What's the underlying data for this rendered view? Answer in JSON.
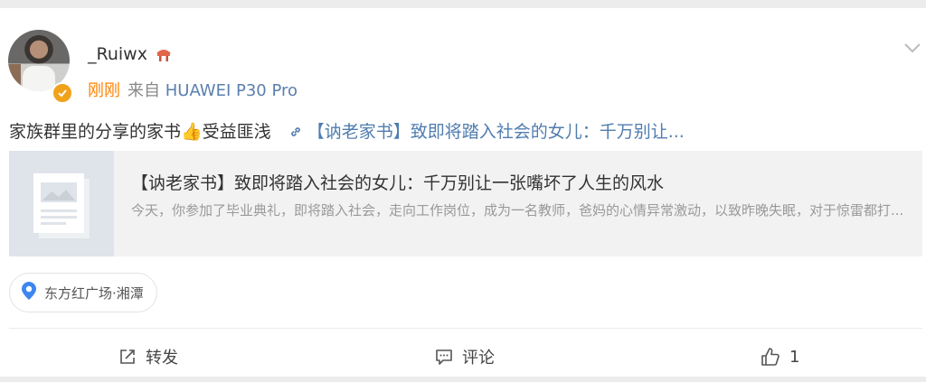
{
  "post": {
    "author": {
      "username": "_Ruiwx",
      "verified_color": "#f0a21b"
    },
    "time": "刚刚",
    "source_prefix": "来自",
    "device": "HUAWEI P30 Pro",
    "text": "家族群里的分享的家书👍受益匪浅",
    "link_text": "【讷老家书】致即将踏入社会的女儿：千万别让..."
  },
  "preview": {
    "title": "【讷老家书】致即将踏入社会的女儿：千万别让一张嘴坏了人生的风水",
    "description": "今天，你参加了毕业典礼，即将踏入社会，走向工作岗位，成为一名教师，爸妈的心情异常激动，以致昨晚失眠，对于惊雷都打..."
  },
  "location": {
    "label": "东方红广场·湘潭",
    "icon": "map-pin-icon"
  },
  "actions": {
    "repost_label": "转发",
    "comment_label": "评论",
    "like_count": "1"
  },
  "colors": {
    "accent_orange": "#ff8200",
    "link_blue": "#507daf",
    "device_blue": "#5b7faf"
  }
}
